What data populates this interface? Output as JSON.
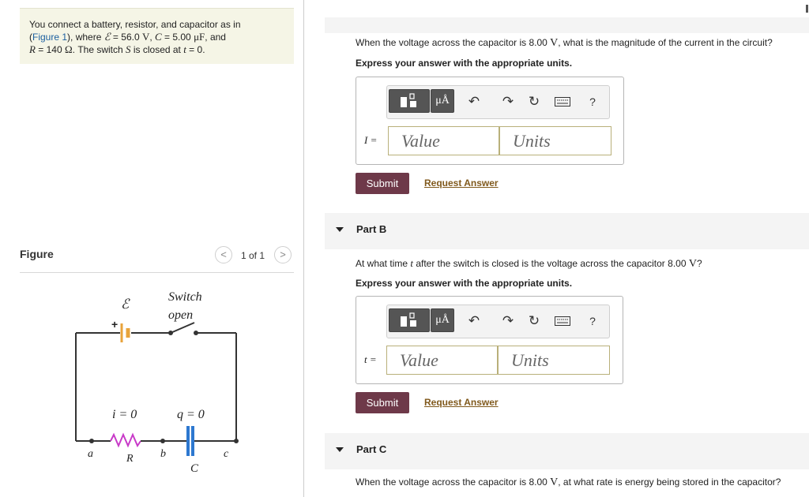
{
  "problem": {
    "line1": "You connect a battery, resistor, and capacitor as in",
    "figure_link": "Figure 1",
    "where": "), where ",
    "emf_symbol": "ℰ",
    "emf_value": " = 56.0 ",
    "emf_unit": "V",
    "cap_sep": ", ",
    "c_symbol": "C",
    "c_value": " = 5.00 ",
    "c_unit": "μF",
    "and": ", and",
    "r_symbol": "R",
    "r_value": " = 140 ",
    "r_unit": "Ω",
    "switch_text": ". The switch ",
    "s_symbol": "S",
    "closed_text": " is closed at ",
    "t_symbol": "t",
    "t_value": " = 0."
  },
  "figure": {
    "title": "Figure",
    "page": "1 of 1",
    "prev": "<",
    "next": ">"
  },
  "circuit": {
    "emf": "ℰ",
    "plus": "+",
    "switch_label": "Switch",
    "switch_state": "open",
    "current": "i = 0",
    "charge": "q = 0",
    "a": "a",
    "r": "R",
    "b": "b",
    "c_node": "c",
    "c_label": "C"
  },
  "part_a": {
    "question_prefix": "When the voltage across the capacitor is 8.00 ",
    "question_unit": "V",
    "question_suffix": ", what is the magnitude of the current in the circuit?",
    "instruction": "Express your answer with the appropriate units.",
    "var": "I =",
    "value_placeholder": "Value",
    "units_placeholder": "Units",
    "submit": "Submit",
    "request": "Request Answer"
  },
  "part_b": {
    "label": "Part B",
    "question_prefix": "At what time ",
    "question_var": "t",
    "question_mid": " after the switch is closed is the voltage across the capacitor 8.00 ",
    "question_unit": "V",
    "question_suffix": "?",
    "instruction": "Express your answer with the appropriate units.",
    "var": "t =",
    "value_placeholder": "Value",
    "units_placeholder": "Units",
    "submit": "Submit",
    "request": "Request Answer"
  },
  "part_c": {
    "label": "Part C",
    "question_prefix": "When the voltage across the capacitor is 8.00 ",
    "question_unit": "V",
    "question_suffix": ", at what rate is energy being stored in the capacitor?"
  },
  "toolbar": {
    "mu_label": "μÅ",
    "undo_icon": "undo-icon",
    "redo_icon": "redo-icon",
    "reset_icon": "reset-icon",
    "keyboard_icon": "keyboard-icon",
    "help": "?"
  },
  "colors": {
    "submit_bg": "#6e3949",
    "link": "#80591c",
    "problem_bg": "#f5f5e6",
    "input_border": "#b9b07a"
  }
}
